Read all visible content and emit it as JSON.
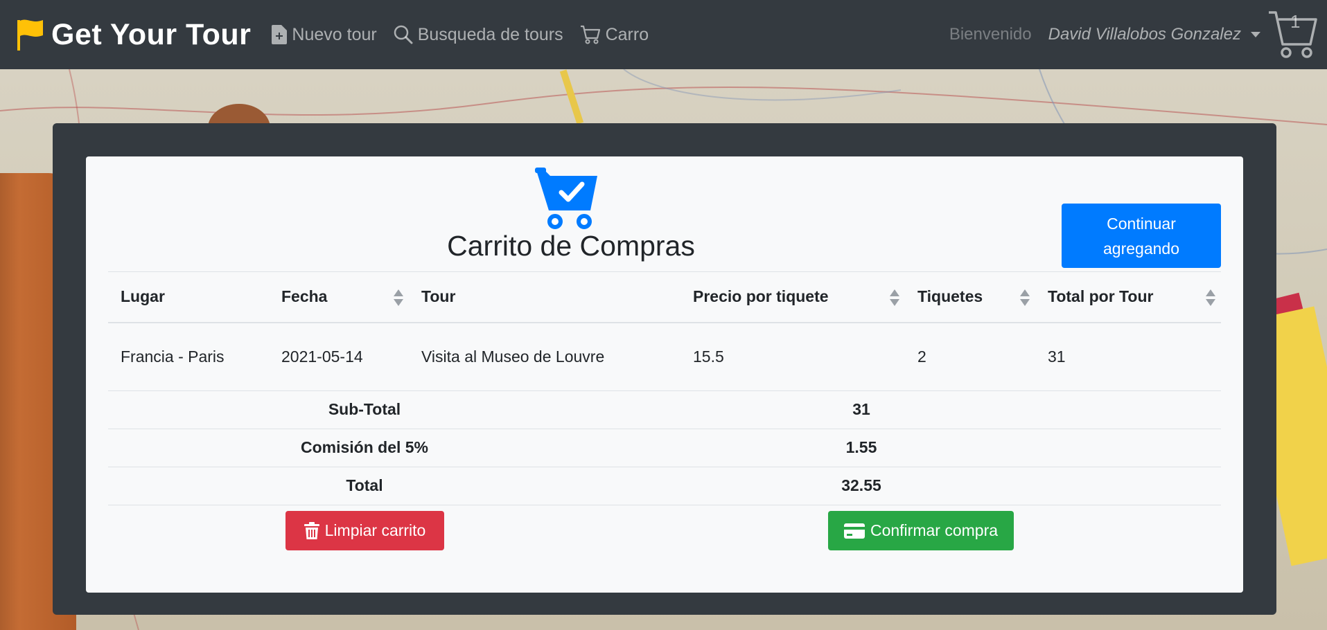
{
  "navbar": {
    "brand": "Get Your Tour",
    "links": [
      {
        "label": "Nuevo tour",
        "icon": "file-plus-icon"
      },
      {
        "label": "Busqueda de tours",
        "icon": "search-icon"
      },
      {
        "label": "Carro",
        "icon": "cart-icon"
      }
    ],
    "welcome": "Bienvenido",
    "user": "David Villalobos Gonzalez",
    "cart_count": "1"
  },
  "panel": {
    "title": "Carrito de Compras",
    "continue_button": "Continuar\nagregando"
  },
  "table": {
    "columns": [
      "Lugar",
      "Fecha",
      "Tour",
      "Precio por tiquete",
      "Tiquetes",
      "Total por Tour"
    ],
    "rows": [
      [
        "Francia - Paris",
        "2021-05-14",
        "Visita al Museo de Louvre",
        "15.5",
        "2",
        "31"
      ]
    ]
  },
  "summary": {
    "subtotal_label": "Sub-Total",
    "subtotal_value": "31",
    "commission_label": "Comisión del 5%",
    "commission_value": "1.55",
    "total_label": "Total",
    "total_value": "32.55"
  },
  "actions": {
    "clear_label": "Limpiar carrito",
    "confirm_label": "Confirmar compra"
  },
  "colors": {
    "navbar": "#343a40",
    "primary": "#007bff",
    "danger": "#dc3545",
    "success": "#28a745",
    "brand_flag": "#ffc107"
  }
}
